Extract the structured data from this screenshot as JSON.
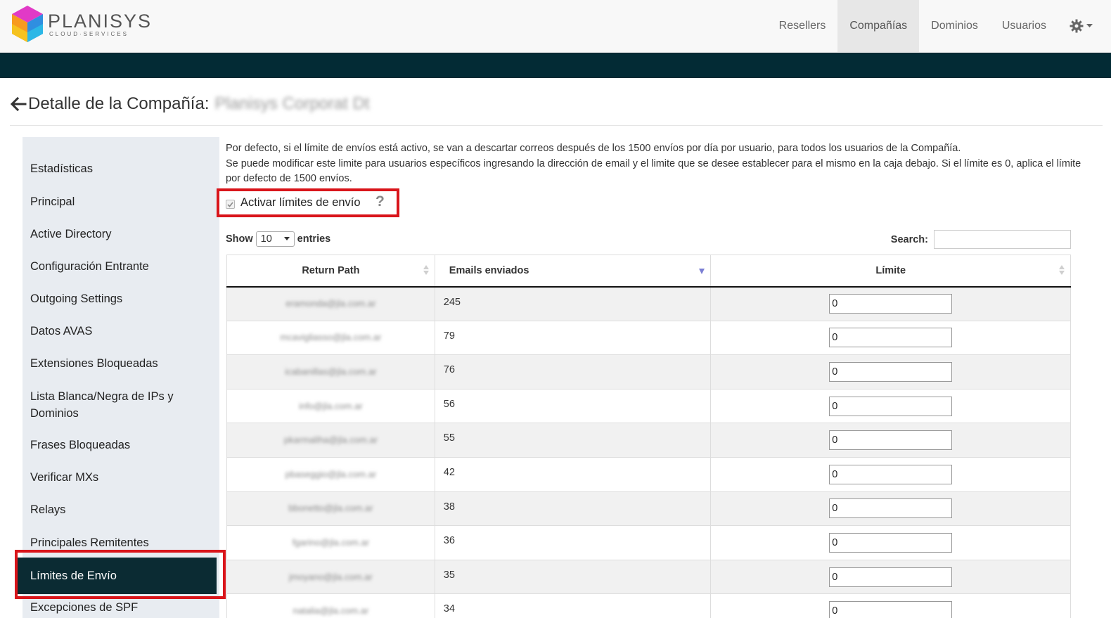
{
  "header": {
    "brand": "PLANISYS",
    "brand_sub": "CLOUD·SERVICES",
    "nav": [
      {
        "label": "Resellers"
      },
      {
        "label": "Compañías"
      },
      {
        "label": "Dominios"
      },
      {
        "label": "Usuarios"
      }
    ]
  },
  "page": {
    "title": "Detalle de la Compañía:",
    "company_name": "Planisys Corporat  Dt"
  },
  "sidebar": {
    "items": [
      {
        "label": "Estadísticas"
      },
      {
        "label": "Principal"
      },
      {
        "label": "Active Directory"
      },
      {
        "label": "Configuración Entrante"
      },
      {
        "label": "Outgoing Settings"
      },
      {
        "label": "Datos AVAS"
      },
      {
        "label": "Extensiones Bloqueadas"
      },
      {
        "label": "Lista Blanca/Negra de IPs y Dominios"
      },
      {
        "label": "Frases Bloqueadas"
      },
      {
        "label": "Verificar MXs"
      },
      {
        "label": "Relays"
      },
      {
        "label": "Principales Remitentes"
      },
      {
        "label": "Límites de Envío"
      },
      {
        "label": "Excepciones de SPF"
      }
    ]
  },
  "content": {
    "description_1": "Por defecto, si el límite de envíos está activo, se van a descartar correos después de los 1500 envíos por día por usuario, para todos los usuarios de la Compañía.",
    "description_2": "Se puede modificar este limite para usuarios específicos ingresando la dirección de email y el limite que se desee establecer para el mismo en la caja debajo. Si el límite es 0, aplica el límite por defecto de 1500 envíos.",
    "checkbox_label": "Activar límites de envío",
    "checkbox_checked": true,
    "help_glyph": "?",
    "show_label": "Show",
    "entries_value": "10",
    "entries_label": "entries",
    "search_label": "Search:",
    "search_value": ""
  },
  "table": {
    "columns": [
      "Return Path",
      "Emails enviados",
      "Límite"
    ],
    "rows": [
      {
        "email": "eramonda@jla.com.ar",
        "sent": "245",
        "limit": "0"
      },
      {
        "email": "mcavigliasso@jla.com.ar",
        "sent": "79",
        "limit": "0"
      },
      {
        "email": "icabanillas@jla.com.ar",
        "sent": "76",
        "limit": "0"
      },
      {
        "email": "info@jla.com.ar",
        "sent": "56",
        "limit": "0"
      },
      {
        "email": "pkarmaliha@jla.com.ar",
        "sent": "55",
        "limit": "0"
      },
      {
        "email": "pbaseggio@jla.com.ar",
        "sent": "42",
        "limit": "0"
      },
      {
        "email": "bbonetto@jla.com.ar",
        "sent": "38",
        "limit": "0"
      },
      {
        "email": "fgarino@jla.com.ar",
        "sent": "36",
        "limit": "0"
      },
      {
        "email": "jmoyano@jla.com.ar",
        "sent": "35",
        "limit": "0"
      },
      {
        "email": "natalia@jla.com.ar",
        "sent": "34",
        "limit": "0"
      }
    ]
  },
  "colors": {
    "dark_bar": "#032b35",
    "sidebar_bg": "#e8ecf1",
    "sidebar_active": "#0b2b33",
    "highlight_red": "#d9151b"
  }
}
